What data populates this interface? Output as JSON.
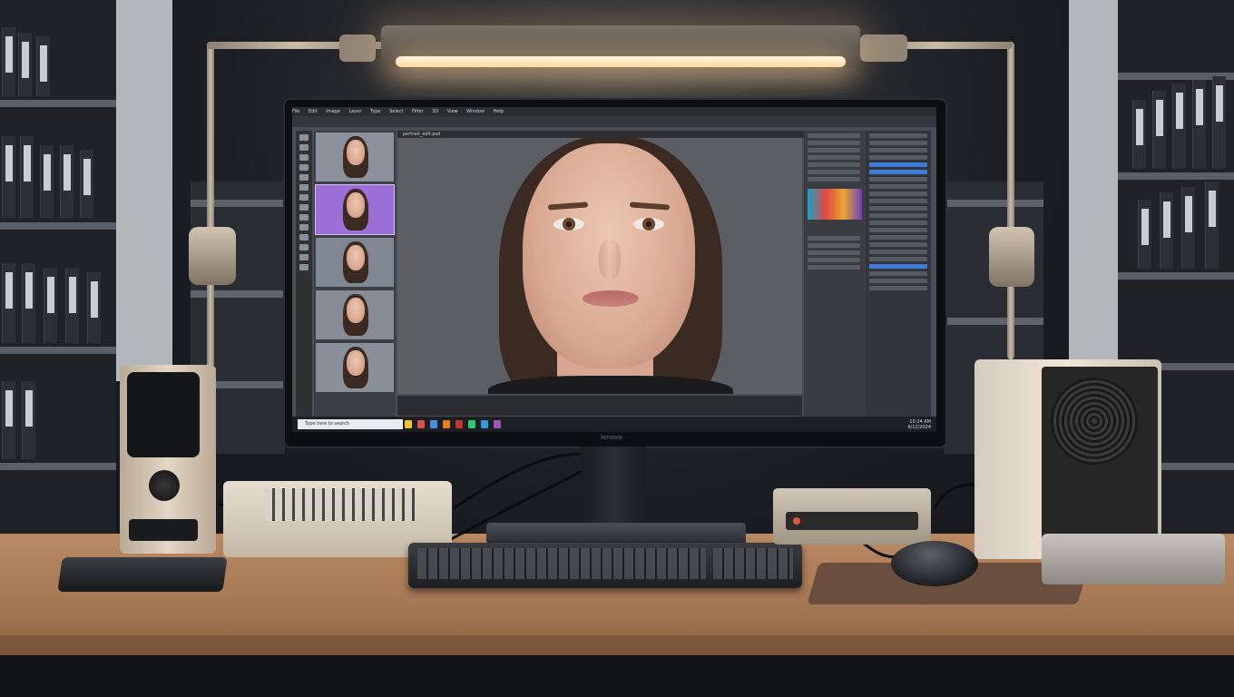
{
  "scene": {
    "description_tag": "",
    "monitor_brand": "lenovo"
  },
  "editor": {
    "menu_items": [
      "File",
      "Edit",
      "Image",
      "Layer",
      "Type",
      "Select",
      "Filter",
      "3D",
      "View",
      "Window",
      "Help"
    ],
    "document_tab": "portrait_edit.psd",
    "taskbar_search": "Type here to search",
    "clock_time": "10:24 AM",
    "clock_date": "6/12/2024",
    "thumbnail_count": 5,
    "selected_thumbnail": 2
  },
  "colors": {
    "lamp_glow": "#ffd9a0",
    "panel_selection": "#3c7bd9",
    "thumb_highlight": "#9b6fd6",
    "desk_wood": "#b98a62"
  }
}
